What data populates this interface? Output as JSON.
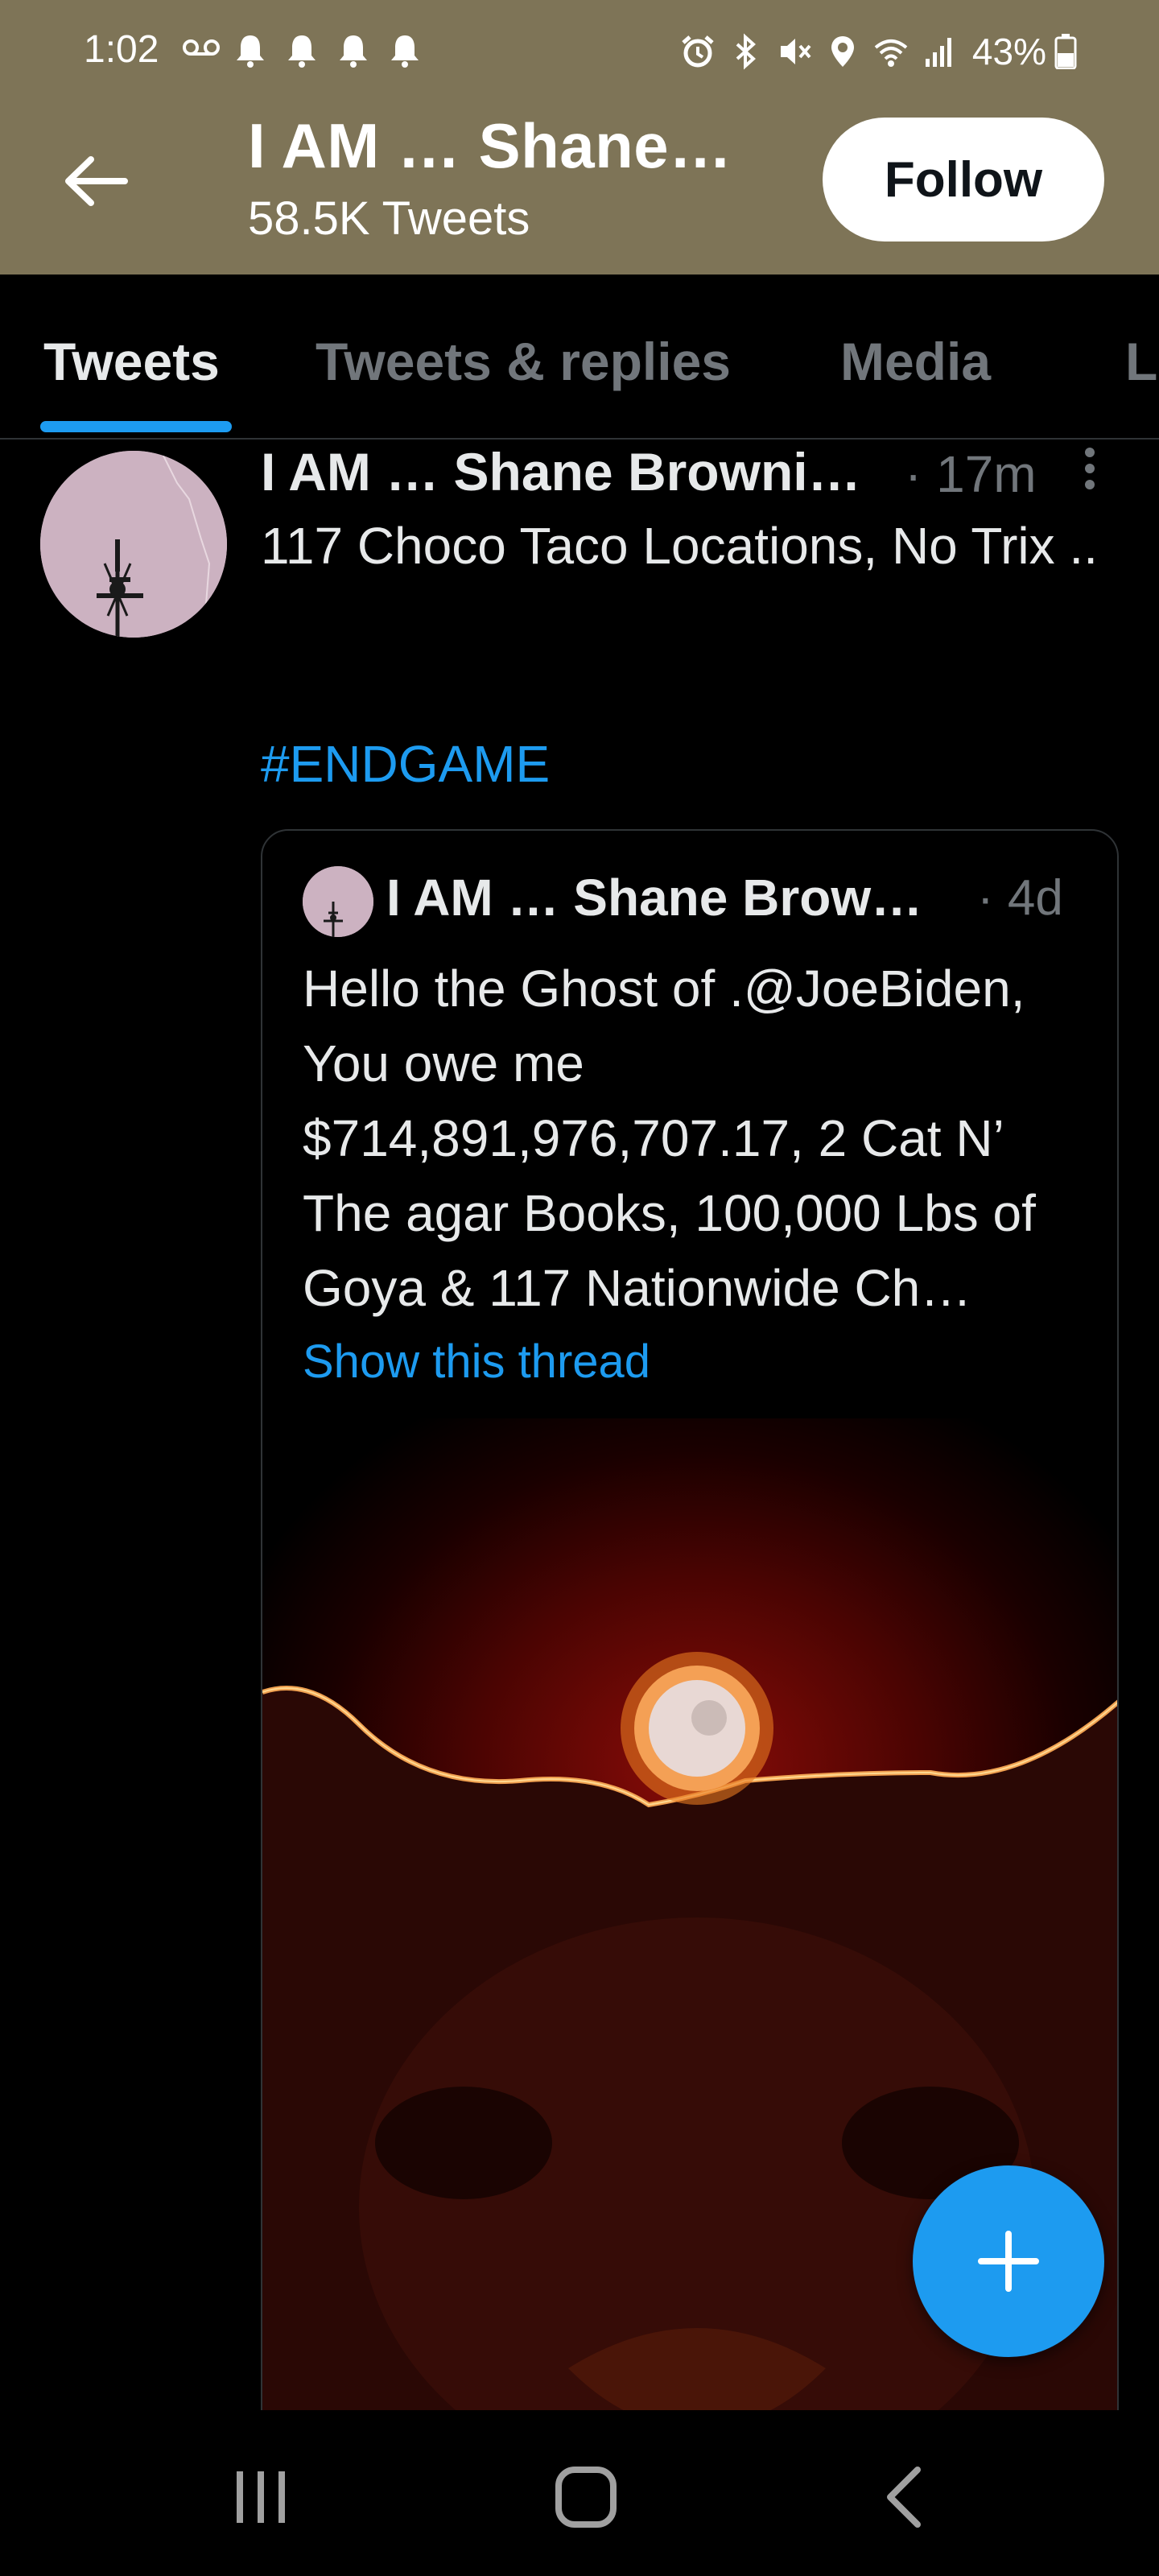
{
  "status_bar": {
    "time": "1:02",
    "battery": "43%"
  },
  "profile": {
    "name": "I AM … Shane…",
    "tweet_count": "58.5K Tweets",
    "follow_label": "Follow",
    "header_color": "#7e7457"
  },
  "tabs": [
    {
      "label": "Tweets",
      "active": true
    },
    {
      "label": "Tweets & replies",
      "active": false
    },
    {
      "label": "Media",
      "active": false
    },
    {
      "label": "L",
      "active": false
    }
  ],
  "tweet": {
    "author": "I AM … Shane Browni…",
    "meta": "· 17m",
    "text": "117 Choco Taco Locations, No Trix ..",
    "hashtag": "#ENDGAME",
    "quoted": {
      "author": "I AM … Shane Brow…",
      "meta": "· 4d",
      "text": "Hello the Ghost of .@JoeBiden, You owe me $714,891,976,707.17, 2 Cat N’ The agar Books, 100,000 Lbs of Goya & 117 Nationwide Ch…",
      "show_thread": "Show this thread"
    }
  },
  "icons": {
    "back": "arrow-left-icon",
    "more": "more-vertical-icon",
    "compose": "plus-icon",
    "nav_recents": "recents-icon",
    "nav_home": "home-icon",
    "nav_back": "back-chevron-icon"
  },
  "colors": {
    "accent": "#1d9bf0",
    "background": "#000000",
    "secondary_text": "#71767b"
  }
}
